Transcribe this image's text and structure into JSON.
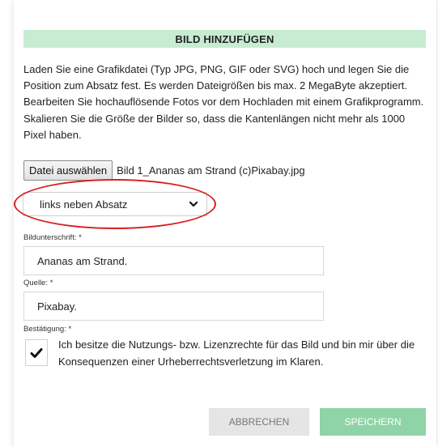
{
  "dialog": {
    "title": "BILD HINZUFÜGEN",
    "intro": "Laden Sie eine Grafikdatei (Typ JPG, PNG, GIF oder SVG) hoch und legen Sie die Position zum Absatz fest. Es werden Dateigrößen bis max. 2 MegaByte akzeptiert. Bearbeiten Sie hochauflösende Fotos vor dem Hochladen mit einem Grafikprogramm. Skalieren Sie die Größe der Bilder so, dass die Kantenlängen nicht mehr als 1000 Pixel haben."
  },
  "file": {
    "button_label": "Datei auswählen",
    "selected_name": "Bild 1_Ananas am Strand (c)Pixabay.jpg"
  },
  "position_select": {
    "value": "links neben Absatz"
  },
  "caption": {
    "label": "Bildunterschrift: *",
    "value": "Ananas am Strand."
  },
  "source": {
    "label": "Quelle: *",
    "value": "Pixabay."
  },
  "confirmation": {
    "label": "Bestätigung: *",
    "checked": true,
    "text": "Ich besitze die Nutzungs- bzw. Lizenzrechte für das Bild und bin mir über die Konsequenzen einer Urheberrechtsverletzung im Klaren."
  },
  "actions": {
    "cancel_label": "ABBRECHEN",
    "save_label": "SPEICHERN"
  },
  "colors": {
    "title_bar": "#c7ecd2",
    "save_button": "#8fd4a6",
    "cancel_button": "#e5e5e5",
    "highlight_ellipse": "#d81f1f"
  }
}
